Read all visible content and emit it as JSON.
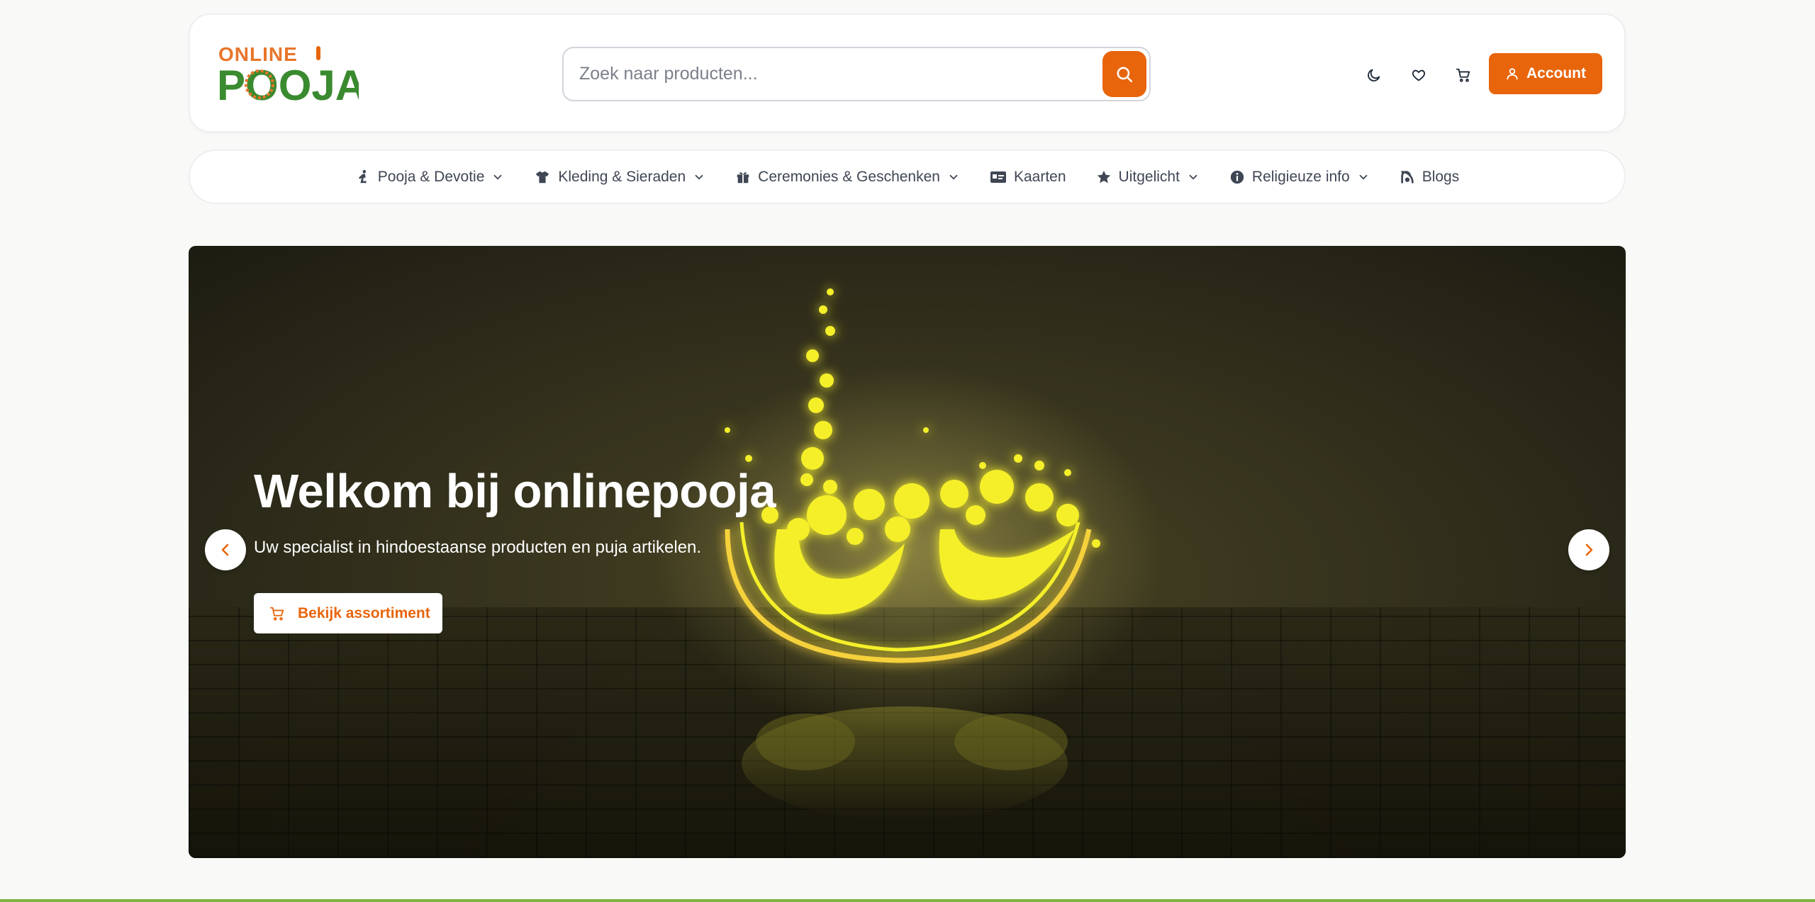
{
  "logo": {
    "line1": "ONLINE",
    "line2": "POOJA"
  },
  "search": {
    "placeholder": "Zoek naar producten..."
  },
  "header": {
    "account_label": "Account"
  },
  "nav": {
    "items": [
      {
        "label": "Pooja & Devotie",
        "icon": "pray-icon",
        "dropdown": true
      },
      {
        "label": "Kleding & Sieraden",
        "icon": "shirt-icon",
        "dropdown": true
      },
      {
        "label": "Ceremonies & Geschenken",
        "icon": "gift-icon",
        "dropdown": true
      },
      {
        "label": "Kaarten",
        "icon": "card-icon",
        "dropdown": false
      },
      {
        "label": "Uitgelicht",
        "icon": "star-icon",
        "dropdown": true
      },
      {
        "label": "Religieuze info",
        "icon": "info-icon",
        "dropdown": true
      },
      {
        "label": "Blogs",
        "icon": "blog-icon",
        "dropdown": false
      }
    ]
  },
  "hero": {
    "title": "Welkom bij onlinepooja",
    "subtitle": "Uw specialist in hindoestaanse producten en puja artikelen.",
    "cta_label": "Bekijk assortiment"
  },
  "colors": {
    "accent": "#e8650b",
    "brand_green": "#3a8a2f",
    "strip": "#7cb342"
  }
}
